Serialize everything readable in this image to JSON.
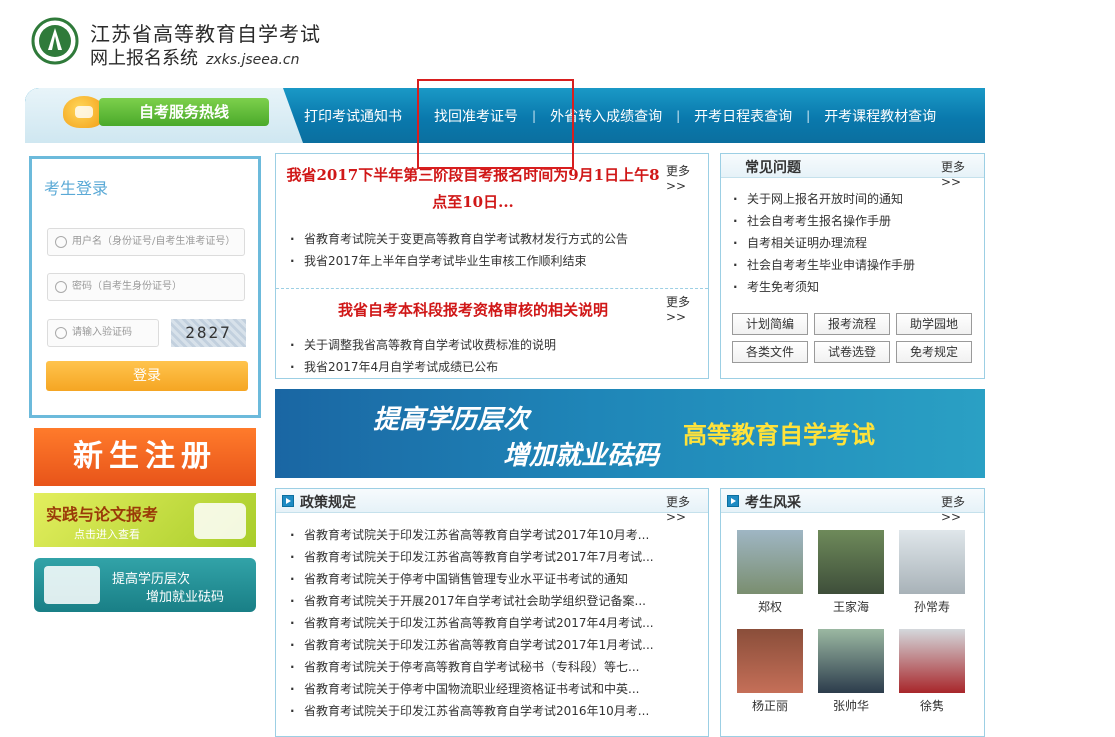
{
  "header": {
    "title_line1": "江苏省高等教育自学考试",
    "title_line2": "网上报名系统",
    "url": "zxks.jseea.cn"
  },
  "nav": {
    "hotline_label": "自考服务热线",
    "items": [
      "打印考试通知书",
      "找回准考证号",
      "外省转入成绩查询",
      "开考日程表查询",
      "开考课程教材查询"
    ],
    "separator": "|"
  },
  "login": {
    "title": "考生登录",
    "username_placeholder": "用户名（身份证号/自考生准考证号）",
    "password_placeholder": "密码（自考生身份证号）",
    "captcha_placeholder": "请输入验证码",
    "captcha_code": "2827",
    "submit_label": "登录"
  },
  "banners": {
    "register": "新生注册",
    "practice_line1": "实践与论文报考",
    "practice_line2": "点击进入查看",
    "upgrade_line1": "提高学历层次",
    "upgrade_line2": "增加就业砝码"
  },
  "news": {
    "more": "更多>>",
    "headline1": "我省2017下半年第三阶段自考报名时间为9月1日上午8点至10日...",
    "items1": [
      "省教育考试院关于变更高等教育自学考试教材发行方式的公告",
      "我省2017年上半年自学考试毕业生审核工作顺利结束"
    ],
    "headline2": "我省自考本科段报考资格审核的相关说明",
    "items2": [
      "关于调整我省高等教育自学考试收费标准的说明",
      "我省2017年4月自学考试成绩已公布"
    ]
  },
  "faq": {
    "title": "常见问题",
    "more": "更多>>",
    "items": [
      "关于网上报名开放时间的通知",
      "社会自考考生报名操作手册",
      "自考相关证明办理流程",
      "社会自考考生毕业申请操作手册",
      "考生免考须知"
    ],
    "buttons": [
      "计划简编",
      "报考流程",
      "助学园地",
      "各类文件",
      "试卷选登",
      "免考规定"
    ]
  },
  "mid_banner": {
    "line1": "提高学历层次",
    "line2": "增加就业砝码",
    "right": "高等教育自学考试"
  },
  "policy": {
    "title": "政策规定",
    "more": "更多>>",
    "items": [
      "省教育考试院关于印发江苏省高等教育自学考试2017年10月考...",
      "省教育考试院关于印发江苏省高等教育自学考试2017年7月考试...",
      "省教育考试院关于停考中国销售管理专业水平证书考试的通知",
      "省教育考试院关于开展2017年自学考试社会助学组织登记备案...",
      "省教育考试院关于印发江苏省高等教育自学考试2017年4月考试...",
      "省教育考试院关于印发江苏省高等教育自学考试2017年1月考试...",
      "省教育考试院关于停考高等教育自学考试秘书（专科段）等七...",
      "省教育考试院关于停考中国物流职业经理资格证书考试和中英...",
      "省教育考试院关于印发江苏省高等教育自学考试2016年10月考..."
    ]
  },
  "students": {
    "title": "考生风采",
    "more": "更多>>",
    "names": [
      "郑权",
      "王家海",
      "孙常寿",
      "杨正丽",
      "张帅华",
      "徐隽"
    ]
  }
}
